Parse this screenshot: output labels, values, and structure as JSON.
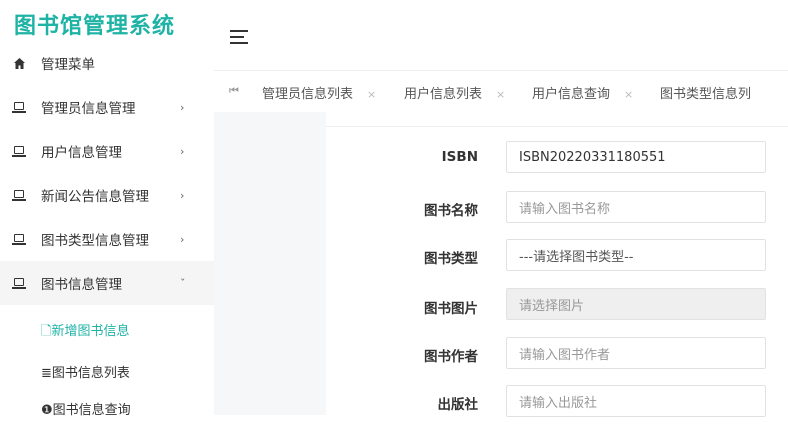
{
  "app": {
    "title": "图书馆管理系统"
  },
  "sidebar": {
    "items": [
      {
        "label": "管理菜单",
        "icon": "home-icon"
      },
      {
        "label": "管理员信息管理",
        "icon": "laptop-icon",
        "chevron": "›"
      },
      {
        "label": "用户信息管理",
        "icon": "laptop-icon",
        "chevron": "›"
      },
      {
        "label": "新闻公告信息管理",
        "icon": "laptop-icon",
        "chevron": "›"
      },
      {
        "label": "图书类型信息管理",
        "icon": "laptop-icon",
        "chevron": "›"
      },
      {
        "label": "图书信息管理",
        "icon": "laptop-icon",
        "chevron": "ˇ"
      }
    ],
    "subitems": [
      {
        "label": "🗋新增图书信息"
      },
      {
        "label": "≣图书信息列表"
      },
      {
        "label": "❶图书信息查询"
      }
    ]
  },
  "tabs": {
    "first_icon": "⏮",
    "items": [
      {
        "label": "管理员信息列表",
        "close": "×"
      },
      {
        "label": "用户信息列表",
        "close": "×"
      },
      {
        "label": "用户信息查询",
        "close": "×"
      },
      {
        "label": "图书类型信息列"
      }
    ]
  },
  "form": {
    "isbn": {
      "label": "ISBN",
      "value": "ISBN20220331180551"
    },
    "name": {
      "label": "图书名称",
      "placeholder": "请输入图书名称"
    },
    "type": {
      "label": "图书类型",
      "selected": "---请选择图书类型--"
    },
    "image": {
      "label": "图书图片",
      "placeholder": "请选择图片"
    },
    "author": {
      "label": "图书作者",
      "placeholder": "请输入图书作者"
    },
    "publisher": {
      "label": "出版社",
      "placeholder": "请输入出版社"
    }
  },
  "colors": {
    "accent": "#1fb3a6"
  }
}
